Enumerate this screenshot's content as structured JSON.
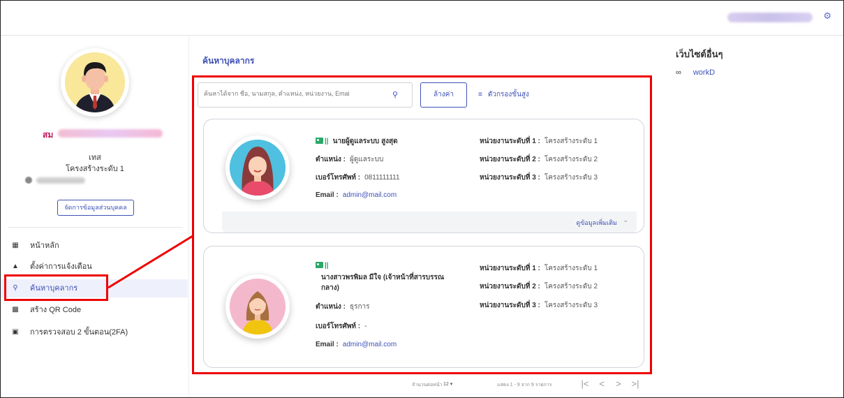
{
  "topbar": {
    "settings_icon": "gear-icon"
  },
  "profile": {
    "name_prefix": "สม",
    "first_name": "เทส",
    "structure": "โครงสร้างระดับ 1",
    "manage_button": "จัดการข้อมูลส่วนบุคคล"
  },
  "nav": {
    "items": [
      {
        "label": "หน้าหลัก",
        "icon": "grid-icon"
      },
      {
        "label": "ตั้งค่าการแจ้งเตือน",
        "icon": "bell-icon"
      },
      {
        "label": "ค้นหาบุคลากร",
        "icon": "search-icon",
        "active": true
      },
      {
        "label": "สร้าง QR Code",
        "icon": "qr-code-icon"
      },
      {
        "label": "การตรวจสอบ 2 ขั้นตอน(2FA)",
        "icon": "two-factor-icon"
      }
    ]
  },
  "main": {
    "title": "ค้นหาบุคลากร",
    "search_placeholder": "ค้นหาได้จาก ชื่อ, นามสกุล, ตำแหน่ง, หน่วยงาน, Emai",
    "clear_button": "ล้างค่า",
    "advanced_filter": "ตัวกรองขั้นสูง"
  },
  "people": [
    {
      "name": "นายผู้ดูแลระบบ สูงสุด",
      "position_label": "ตำแหน่ง :",
      "position": "ผู้ดูแลระบบ",
      "phone_label": "เบอร์โทรศัพท์ :",
      "phone": "0811111111",
      "email_label": "Email :",
      "email": "admin@mail.com",
      "unit1_label": "หน่วยงานระดับที่ 1 :",
      "unit1": "โครงสร้างระดับ 1",
      "unit2_label": "หน่วยงานระดับที่ 2 :",
      "unit2": "โครงสร้างระดับ 2",
      "unit3_label": "หน่วยงานระดับที่ 3 :",
      "unit3": "โครงสร้างระดับ 3",
      "more_label": "ดูข้อมูลเพิ่มเติม"
    },
    {
      "name_line1": "นางสาวพรพิมล มีใจ (เจ้าหน้าที่สารบรรณ",
      "name_line2": "กลาง)",
      "position_label": "ตำแหน่ง :",
      "position": "ธุรการ",
      "phone_label": "เบอร์โทรศัพท์ :",
      "phone": "-",
      "email_label": "Email :",
      "email": "admin@mail.com",
      "unit1_label": "หน่วยงานระดับที่ 1 :",
      "unit1": "โครงสร้างระดับ 1",
      "unit2_label": "หน่วยงานระดับที่ 2 :",
      "unit2": "โครงสร้างระดับ 2",
      "unit3_label": "หน่วยงานระดับที่ 3 :",
      "unit3": "โครงสร้างระดับ 3"
    }
  ],
  "pagination": {
    "per_page_label": "จำนวนต่อหน้า",
    "per_page": "12",
    "range": "แสดง 1 - 9 จาก 9 รายการ",
    "first": "|<",
    "prev": "<",
    "next": ">",
    "last": ">|"
  },
  "right": {
    "title": "เว็บไซต์อื่นๆ",
    "links": [
      {
        "label": "workD",
        "icon": "link-icon"
      }
    ]
  }
}
